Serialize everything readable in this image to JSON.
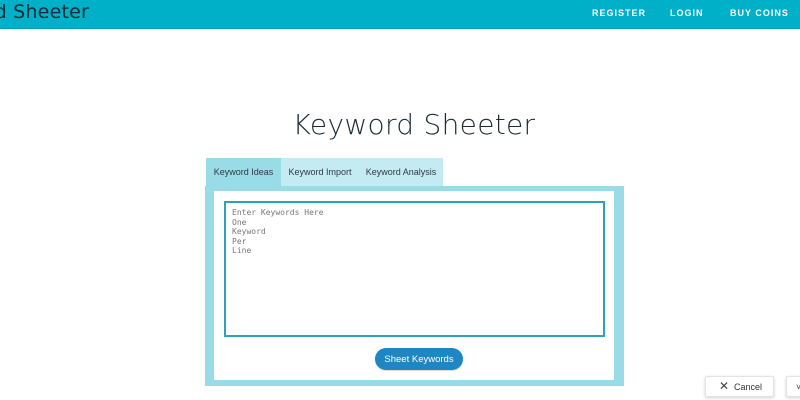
{
  "navbar": {
    "brand": "rd Sheeter",
    "links": {
      "register": "REGISTER",
      "login": "LOGIN",
      "buy_coins": "BUY COINS"
    }
  },
  "page": {
    "title": "Keyword Sheeter"
  },
  "tabs": {
    "keyword_ideas": "Keyword Ideas",
    "keyword_import": "Keyword Import",
    "keyword_analysis": "Keyword Analysis",
    "active": "keyword_ideas"
  },
  "keywords_input": {
    "value": "",
    "placeholder": "Enter Keywords Here\nOne\nKeyword\nPer\nLine"
  },
  "sheet_button": {
    "label": "Sheet Keywords"
  },
  "overlay": {
    "cancel_label": "Cancel",
    "cancel_icon": "close-icon",
    "other_icon": "chevron-icon",
    "other_glyph": "˅"
  },
  "colors": {
    "navbar": "#00b0c8",
    "tab_active": "#9adbe8",
    "tab_inactive": "#c5ebf2",
    "textarea_border": "#2ba4b8",
    "button": "#1f86c4"
  }
}
